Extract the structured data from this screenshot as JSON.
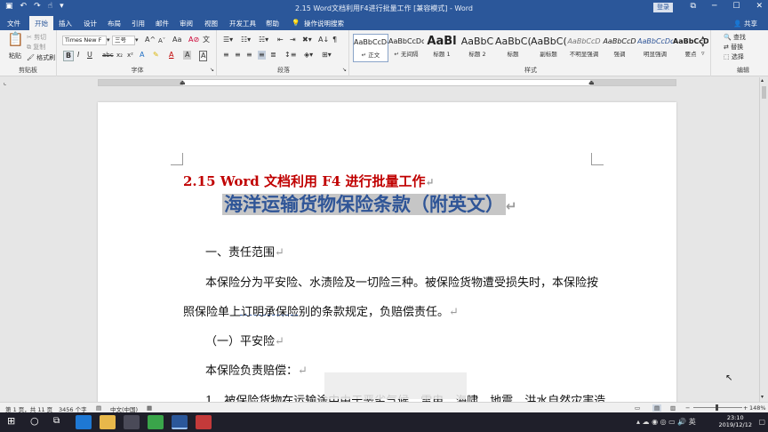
{
  "window": {
    "title": "2.15 Word文档利用F4进行批量工作 [兼容模式] - Word",
    "signin_label": "登录",
    "restore_icon": "restore-icon",
    "minimize_icon": "minimize-icon",
    "maximize_icon": "maximize-icon",
    "close_icon": "close-icon"
  },
  "tabs": [
    {
      "label": "文件"
    },
    {
      "label": "开始",
      "active": true
    },
    {
      "label": "插入"
    },
    {
      "label": "设计"
    },
    {
      "label": "布局"
    },
    {
      "label": "引用"
    },
    {
      "label": "邮件"
    },
    {
      "label": "审阅"
    },
    {
      "label": "视图"
    },
    {
      "label": "开发工具"
    },
    {
      "label": "帮助"
    },
    {
      "label": "操作说明搜索"
    }
  ],
  "share_label": "共享",
  "ribbon": {
    "clipboard": {
      "label": "剪贴板",
      "paste": "粘贴",
      "cut": "剪切",
      "copy": "复制",
      "format_painter": "格式刷"
    },
    "font": {
      "label": "字体",
      "font_name": "Times New F",
      "font_size": "三号"
    },
    "paragraph": {
      "label": "段落"
    },
    "styles": {
      "label": "样式",
      "items": [
        {
          "preview": "AaBbCcDc",
          "name": "↵ 正文"
        },
        {
          "preview": "AaBbCcDc",
          "name": "↵ 无间隔"
        },
        {
          "preview": "AaBl",
          "name": "标题 1"
        },
        {
          "preview": "AaBbC",
          "name": "标题 2"
        },
        {
          "preview": "AaBbC(",
          "name": "标题"
        },
        {
          "preview": "AaBbC(",
          "name": "副标题"
        },
        {
          "preview": "AaBbCcD",
          "name": "不明显强调"
        },
        {
          "preview": "AaBbCcD",
          "name": "强调"
        },
        {
          "preview": "AaBbCcDc",
          "name": "明显强调"
        },
        {
          "preview": "AaBbCcD",
          "name": "要点"
        }
      ]
    },
    "editing": {
      "label": "编辑",
      "find": "查找",
      "replace": "替换",
      "select": "选择"
    }
  },
  "document": {
    "heading": "2.15 Word 文档利用 F4 进行批量工作",
    "title": "海洋运输货物保险条款（附英文）",
    "paragraph_mark": "↵",
    "lines": [
      "一、责任范围",
      "本保险分为平安险、水渍险及一切险三种。被保险货物遭受损失时，本保险按",
      "照保险单上订明承保险别的条款规定，负赔偿责任。",
      "（一）平安险",
      "本保险负责赔偿：",
      "1、被保险货物在运输途中由于恶劣气候、雷电、海啸、地震、洪水自然灾害造"
    ],
    "underlined_phrase": "订明承保险"
  },
  "status": {
    "page": "第 1 页，共 11 页",
    "words": "3456 个字",
    "language": "中文(中国)",
    "zoom": "148%"
  },
  "taskbar": {
    "time": "23:10",
    "date": "2019/12/12"
  },
  "colors": {
    "accent": "#2b579a",
    "heading_red": "#c00000",
    "title_blue": "#2f5597",
    "selection": "#c6c6c6"
  }
}
